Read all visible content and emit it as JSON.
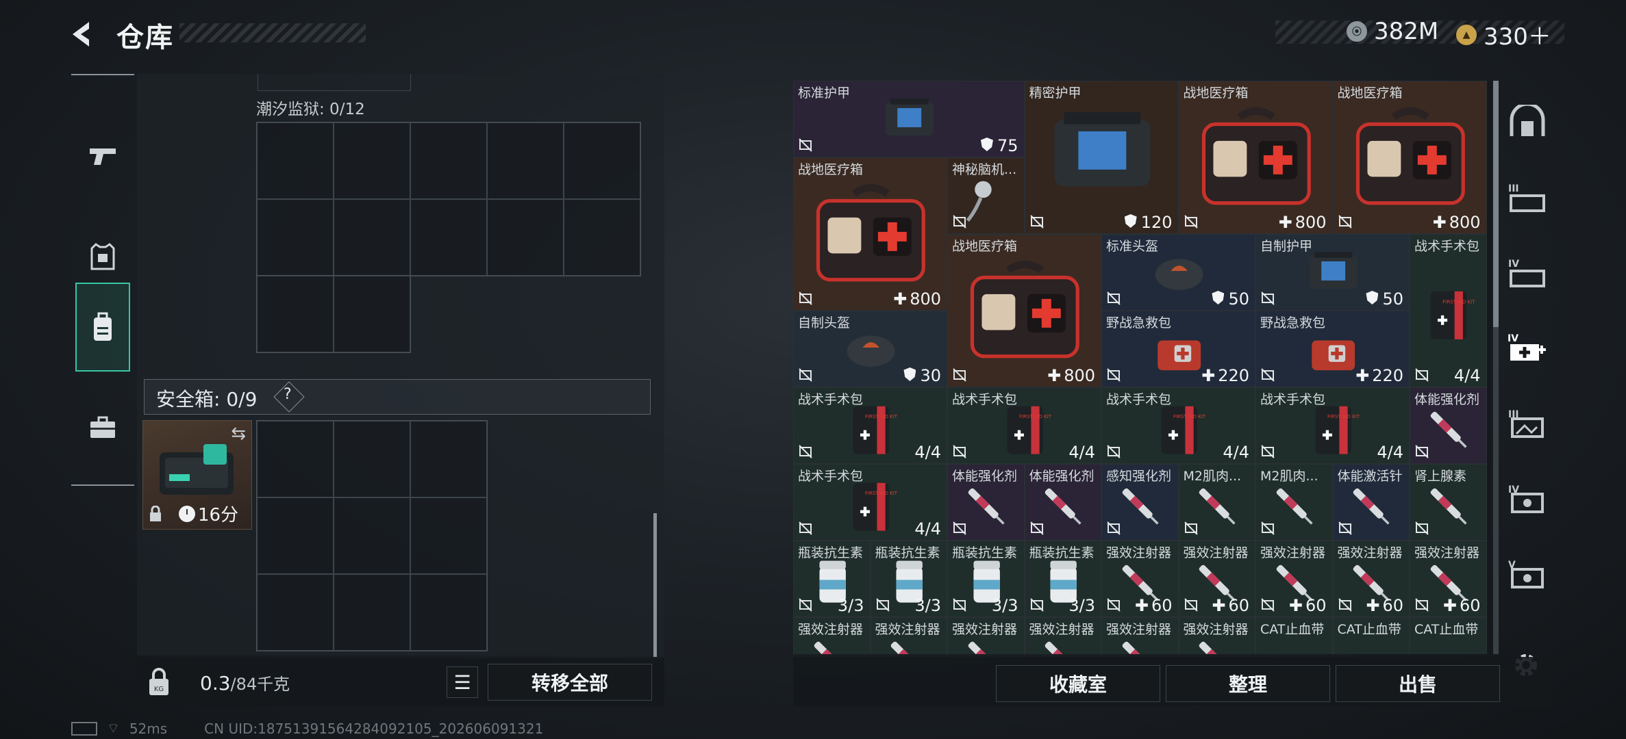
{
  "header": {
    "title": "仓库"
  },
  "currency": [
    {
      "icon": "silver-coin-icon",
      "value": "382M",
      "color": "#9aa3a8"
    },
    {
      "icon": "gold-coin-icon",
      "value": "330＋",
      "color": "#c9a24a"
    }
  ],
  "left_nav": [
    {
      "icon": "pistol-icon"
    },
    {
      "icon": "armor-vest-icon"
    },
    {
      "icon": "backpack-icon",
      "active": true
    },
    {
      "icon": "briefcase-icon"
    }
  ],
  "container": {
    "label": "潮汐监狱: 0/12"
  },
  "safe_box": {
    "label": "安全箱: 0/9",
    "help": "?",
    "timer": "16分"
  },
  "weight": {
    "value": "0.3",
    "unit": "/84千克"
  },
  "buttons": {
    "transfer_all": "转移全部",
    "collection": "收藏室",
    "organize": "整理",
    "sell": "出售"
  },
  "inventory": [
    {
      "name": "标准护甲",
      "value": "75",
      "kind": "shield"
    },
    {
      "name": "精密护甲",
      "value": "120",
      "kind": "shield"
    },
    {
      "name": "战地医疗箱",
      "value": "800",
      "kind": "plus"
    },
    {
      "name": "战地医疗箱",
      "value": "800",
      "kind": "plus"
    },
    {
      "name": "战地医疗箱",
      "value": "800",
      "kind": "plus"
    },
    {
      "name": "神秘脑机...",
      "value": "",
      "kind": "none"
    },
    {
      "name": "战地医疗箱",
      "value": "800",
      "kind": "plus"
    },
    {
      "name": "标准头盔",
      "value": "50",
      "kind": "shield"
    },
    {
      "name": "自制护甲",
      "value": "50",
      "kind": "shield"
    },
    {
      "name": "战术手术包",
      "value": "4/4",
      "kind": "text"
    },
    {
      "name": "自制头盔",
      "value": "30",
      "kind": "shield"
    },
    {
      "name": "野战急救包",
      "value": "220",
      "kind": "plus"
    },
    {
      "name": "野战急救包",
      "value": "220",
      "kind": "plus"
    },
    {
      "name": "战术手术包",
      "value": "4/4",
      "kind": "text"
    },
    {
      "name": "战术手术包",
      "value": "4/4",
      "kind": "text"
    },
    {
      "name": "战术手术包",
      "value": "4/4",
      "kind": "text"
    },
    {
      "name": "战术手术包",
      "value": "4/4",
      "kind": "text"
    },
    {
      "name": "体能强化剂",
      "value": "",
      "kind": "none"
    },
    {
      "name": "战术手术包",
      "value": "4/4",
      "kind": "text"
    },
    {
      "name": "体能强化剂",
      "value": "",
      "kind": "none"
    },
    {
      "name": "体能强化剂",
      "value": "",
      "kind": "none"
    },
    {
      "name": "感知强化剂",
      "value": "",
      "kind": "none"
    },
    {
      "name": "M2肌肉...",
      "value": "",
      "kind": "none"
    },
    {
      "name": "M2肌肉...",
      "value": "",
      "kind": "none"
    },
    {
      "name": "体能激活针",
      "value": "",
      "kind": "none"
    },
    {
      "name": "肾上腺素",
      "value": "",
      "kind": "none"
    },
    {
      "name": "瓶装抗生素",
      "value": "3/3",
      "kind": "text"
    },
    {
      "name": "瓶装抗生素",
      "value": "3/3",
      "kind": "text"
    },
    {
      "name": "瓶装抗生素",
      "value": "3/3",
      "kind": "text"
    },
    {
      "name": "瓶装抗生素",
      "value": "3/3",
      "kind": "text"
    },
    {
      "name": "强效注射器",
      "value": "60",
      "kind": "plus"
    },
    {
      "name": "强效注射器",
      "value": "60",
      "kind": "plus"
    },
    {
      "name": "强效注射器",
      "value": "60",
      "kind": "plus"
    },
    {
      "name": "强效注射器",
      "value": "60",
      "kind": "plus"
    },
    {
      "name": "强效注射器",
      "value": "60",
      "kind": "plus"
    },
    {
      "name": "强效注射器",
      "value": "",
      "kind": "none"
    },
    {
      "name": "强效注射器",
      "value": "",
      "kind": "none"
    },
    {
      "name": "强效注射器",
      "value": "",
      "kind": "none"
    },
    {
      "name": "强效注射器",
      "value": "",
      "kind": "none"
    },
    {
      "name": "强效注射器",
      "value": "",
      "kind": "none"
    },
    {
      "name": "强效注射器",
      "value": "",
      "kind": "none"
    },
    {
      "name": "CAT止血带",
      "value": "",
      "kind": "none"
    },
    {
      "name": "CAT止血带",
      "value": "",
      "kind": "none"
    },
    {
      "name": "CAT止血带",
      "value": "",
      "kind": "none"
    }
  ],
  "right_nav": [
    "vault-icon",
    "tier-iii-storage-icon",
    "tier-iv-storage-icon",
    "tier-iv-medical-icon",
    "tier-iii-image-icon",
    "tier-iv-image-icon",
    "tier-v-image-icon",
    "gear-icon"
  ],
  "status": {
    "ping": "52ms",
    "uid": "CN UID:18751391564284092105_202606091321"
  }
}
